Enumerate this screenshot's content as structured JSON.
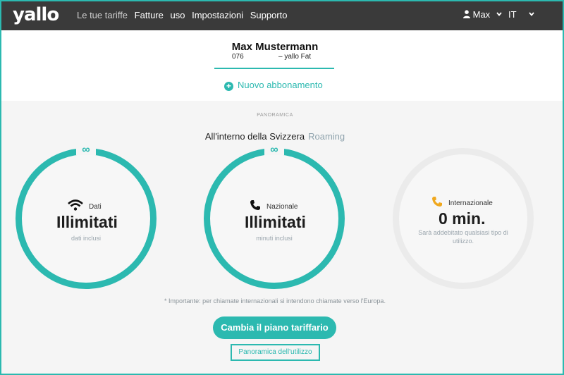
{
  "brand": {
    "logo": "yallo",
    "accent": "#2cb9b0"
  },
  "nav": {
    "items": [
      {
        "label": "Le tue tariffe",
        "active": false
      },
      {
        "label": "Fatture",
        "active": true
      },
      {
        "label": "uso",
        "active": true
      },
      {
        "label": "Impostazioni",
        "active": true
      },
      {
        "label": "Supporto",
        "active": true
      }
    ],
    "user": "Max",
    "language": "IT"
  },
  "account": {
    "name": "Max Mustermann",
    "number": "076",
    "plan": "– yallo Fat",
    "new_subscription": "Nuovo abbonamento"
  },
  "overview": {
    "label": "PANORAMICA",
    "tab_current": "All'interno della Svizzera",
    "tab_other": "Roaming"
  },
  "gauges": [
    {
      "icon": "wifi-icon",
      "title": "Dati",
      "value": "Illimitati",
      "sub": "dati inclusi",
      "infinite": true,
      "infinity_symbol": "∞"
    },
    {
      "icon": "phone-icon",
      "title": "Nazionale",
      "value": "Illimitati",
      "sub": "minuti inclusi",
      "infinite": true,
      "infinity_symbol": "∞"
    },
    {
      "icon": "phone-icon",
      "title": "Internazionale",
      "value": "0 min.",
      "sub": "Sarà addebitato qualsiasi tipo di utilizzo.",
      "infinite": false,
      "icon_color": "#f0a81e"
    }
  ],
  "note": "* Importante: per chiamate internazionali si intendono chiamate verso l'Europa.",
  "actions": {
    "change_plan": "Cambia il piano tariffario",
    "usage_overview": "Panoramica dell'utilizzo"
  }
}
